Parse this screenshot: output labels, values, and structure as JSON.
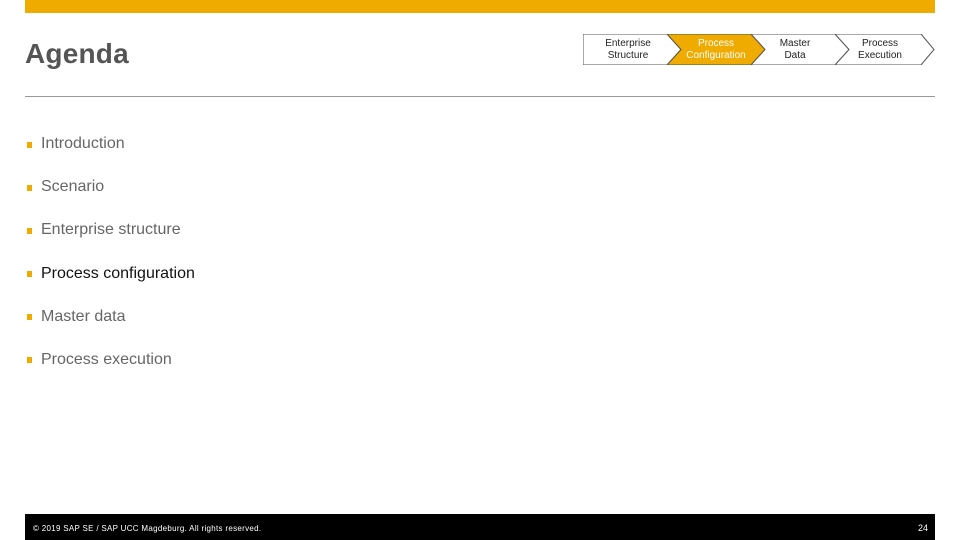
{
  "slide": {
    "title": "Agenda",
    "accent_color": "#f0ab00",
    "progress_steps": [
      {
        "line1": "Enterprise",
        "line2": "Structure",
        "active": false
      },
      {
        "line1": "Process",
        "line2": "Configuration",
        "active": true
      },
      {
        "line1": "Master",
        "line2": "Data",
        "active": false
      },
      {
        "line1": "Process",
        "line2": "Execution",
        "active": false
      }
    ],
    "agenda_items": [
      "Introduction",
      "Scenario",
      "Enterprise structure",
      "Process configuration",
      "Master data",
      "Process execution"
    ],
    "current_item_index": 3
  },
  "footer": {
    "copyright": "© 2019 SAP SE / SAP UCC Magdeburg. All rights reserved.",
    "page_number": "24"
  }
}
